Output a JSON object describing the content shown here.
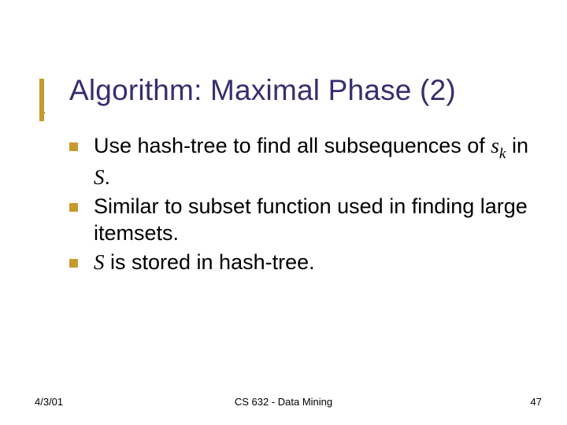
{
  "slide": {
    "title": "Algorithm: Maximal Phase (2)",
    "bullets": [
      {
        "pre": "Use hash-tree to find all subsequences of ",
        "var1": "s",
        "sub1": "k",
        "mid": " in ",
        "var2": "S",
        "post": "."
      },
      {
        "pre": "Similar to subset function used in finding large itemsets.",
        "var1": "",
        "sub1": "",
        "mid": "",
        "var2": "",
        "post": ""
      },
      {
        "pre": "",
        "var1": "S",
        "sub1": "",
        "mid": " is stored in hash-tree.",
        "var2": "",
        "post": ""
      }
    ],
    "footer": {
      "date": "4/3/01",
      "course": "CS 632 - Data Mining",
      "page": "47"
    }
  }
}
